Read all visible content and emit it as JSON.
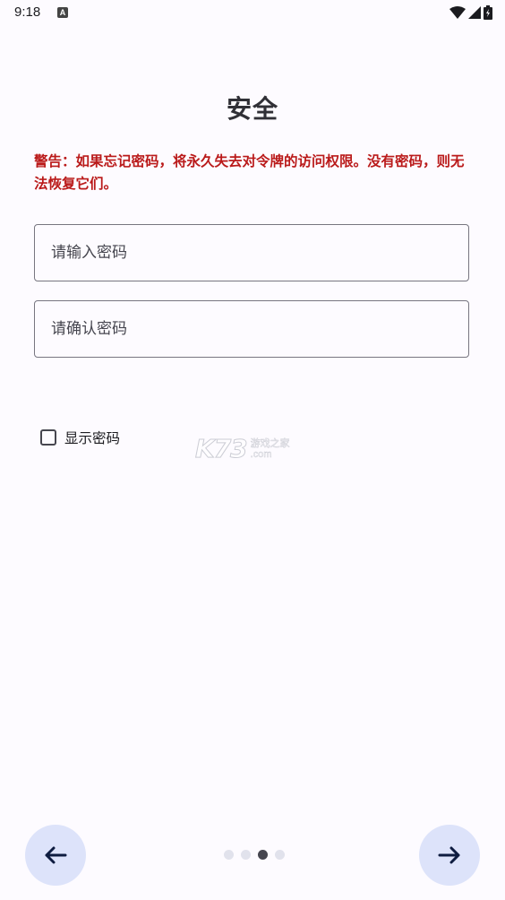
{
  "status_bar": {
    "time": "9:18",
    "notification_icon": "a-icon",
    "wifi_icon": "wifi-icon",
    "signal_icon": "signal-icon",
    "battery_icon": "battery-charging-icon"
  },
  "page": {
    "title": "安全",
    "warning": "警告：如果忘记密码，将永久失去对令牌的访问权限。没有密码，则无法恢复它们。"
  },
  "form": {
    "password_placeholder": "请输入密码",
    "password_value": "",
    "confirm_placeholder": "请确认密码",
    "confirm_value": "",
    "show_password_label": "显示密码",
    "show_password_checked": false
  },
  "watermark": {
    "brand": "K73",
    "cn_text": "游戏之家",
    "domain": ".com"
  },
  "navigation": {
    "back_icon": "arrow-left-icon",
    "next_icon": "arrow-right-icon",
    "page_count": 4,
    "current_page": 3
  },
  "colors": {
    "background": "#FDFBFF",
    "warning": "#BA1A1A",
    "nav_button": "#DDE3FA",
    "dot_active": "#46464F",
    "dot_inactive": "#E1E2EC"
  }
}
